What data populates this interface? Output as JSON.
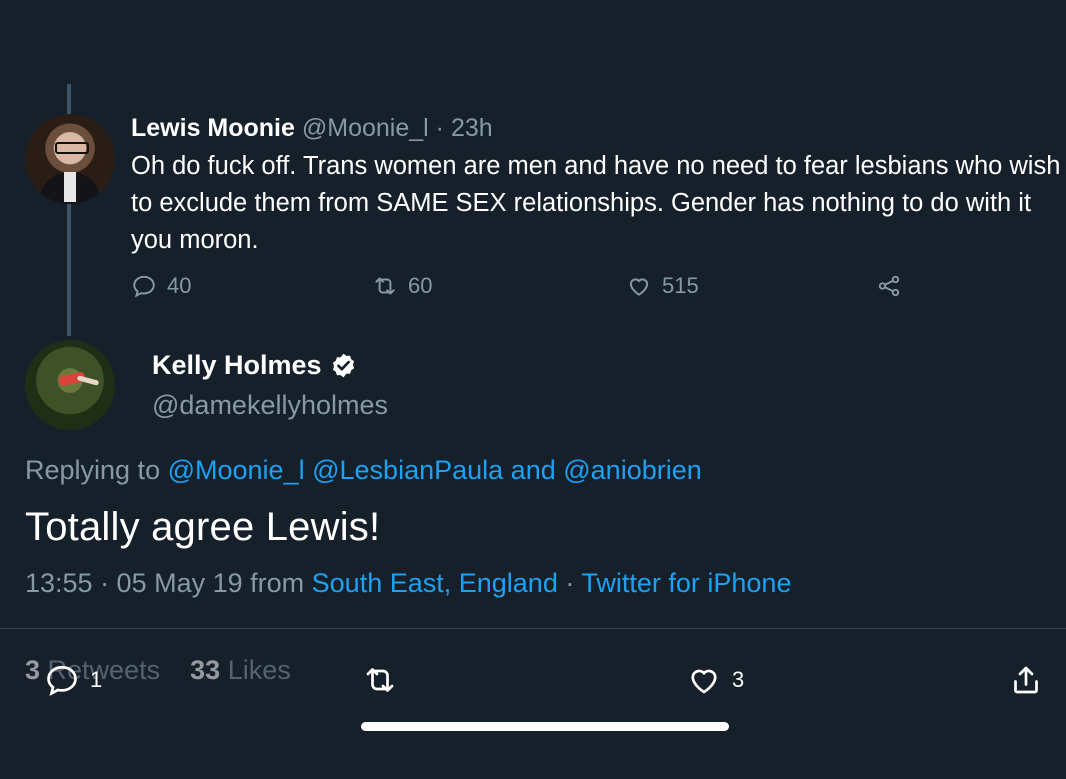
{
  "parent_tweet": {
    "name": "Lewis Moonie",
    "handle": "@Moonie_l",
    "separator": "·",
    "time": "23h",
    "text": "Oh do fuck off. Trans women are men and have no need to fear lesbians who wish to exclude them from SAME SEX relationships. Gender has nothing to do with it you moron.",
    "reply_count": "40",
    "retweet_count": "60",
    "like_count": "515"
  },
  "main_tweet": {
    "name": "Kelly Holmes",
    "handle": "@damekellyholmes",
    "replying_prefix": "Replying to",
    "reply_mention_1": "@Moonie_l",
    "reply_mention_2": "@LesbianPaula",
    "reply_and": "and",
    "reply_mention_3": "@aniobrien",
    "text": "Totally agree Lewis!",
    "timestamp": "13:55 · 05 May 19 from",
    "location": "South East, England",
    "meta_separator": "·",
    "source": "Twitter for iPhone",
    "retweets_count": "3",
    "retweets_label": "Retweets",
    "likes_count": "33",
    "likes_label": "Likes",
    "reply_action_count": "1",
    "like_action_count": "3"
  },
  "colors": {
    "background": "#15202b",
    "link": "#1da1f2",
    "muted": "#8899a6"
  }
}
